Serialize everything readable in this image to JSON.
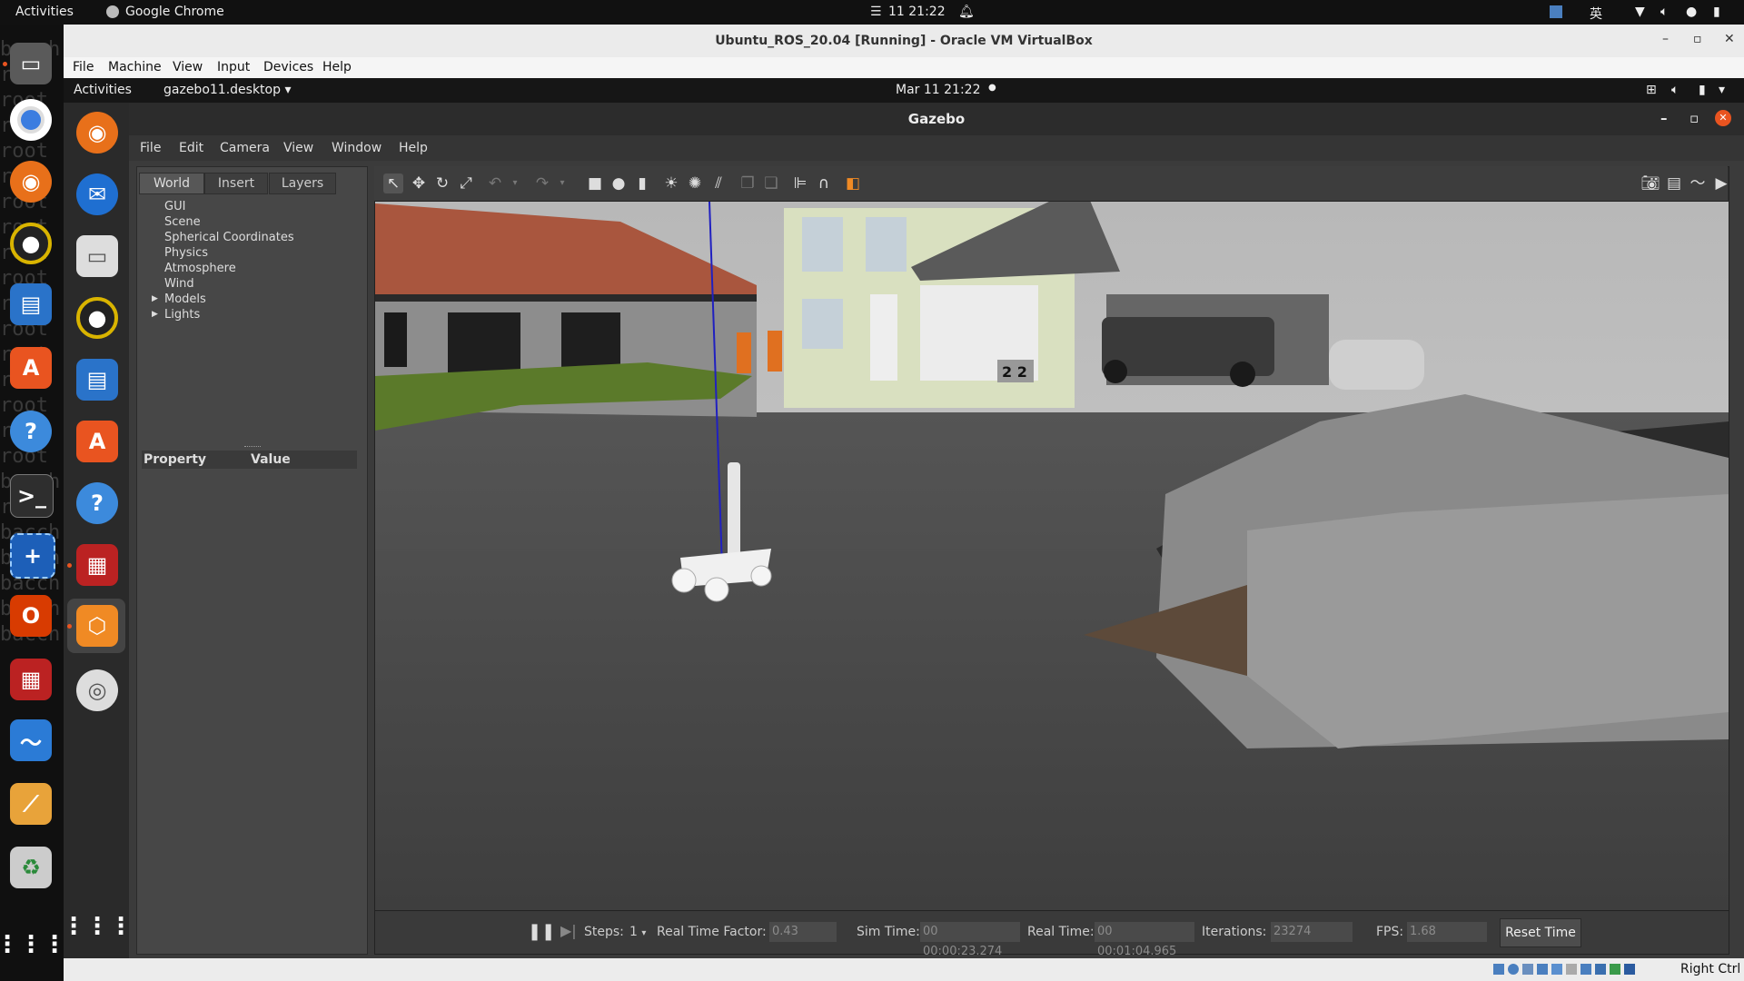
{
  "host": {
    "activities": "Activities",
    "app_name": "Google Chrome",
    "clock": "11 21:22",
    "ime": "英",
    "terminal_text": [
      "bacch",
      "root",
      "root",
      "root",
      "root",
      "root",
      "root",
      "root",
      "root",
      "root",
      "root",
      "root",
      "root",
      "root",
      "root",
      "root",
      "root",
      "bacch",
      "root",
      "bacch",
      "bacch",
      "bacch",
      "bacch",
      "bacch"
    ]
  },
  "vbox": {
    "title": "Ubuntu_ROS_20.04 [Running] - Oracle VM VirtualBox",
    "menu": [
      "File",
      "Machine",
      "View",
      "Input",
      "Devices",
      "Help"
    ],
    "status_right": "Right Ctrl"
  },
  "guest": {
    "activities": "Activities",
    "app_menu": "gazebo11.desktop",
    "clock": "Mar 11  21:22"
  },
  "gazebo": {
    "title": "Gazebo",
    "menu": [
      "File",
      "Edit",
      "Camera",
      "View",
      "Window",
      "Help"
    ],
    "tabs": [
      "World",
      "Insert",
      "Layers"
    ],
    "tree": [
      "GUI",
      "Scene",
      "Spherical Coordinates",
      "Physics",
      "Atmosphere",
      "Wind",
      "Models",
      "Lights"
    ],
    "property_header": "Property",
    "value_header": "Value",
    "garage_number": "2 2",
    "bottom": {
      "steps_label": "Steps:",
      "steps_value": "1",
      "rtf_label": "Real Time Factor:",
      "rtf_value": "0.43",
      "sim_label": "Sim Time:",
      "sim_value": "00 00:00:23.274",
      "real_label": "Real Time:",
      "real_value": "00 00:01:04.965",
      "iter_label": "Iterations:",
      "iter_value": "23274",
      "fps_label": "FPS:",
      "fps_value": "1.68",
      "reset": "Reset Time"
    }
  },
  "colors": {
    "ubuntu_orange": "#e95420",
    "gazebo_bg": "#3b3b3b",
    "sky": "#c8c8c8",
    "asphalt": "#4a4a4a"
  }
}
